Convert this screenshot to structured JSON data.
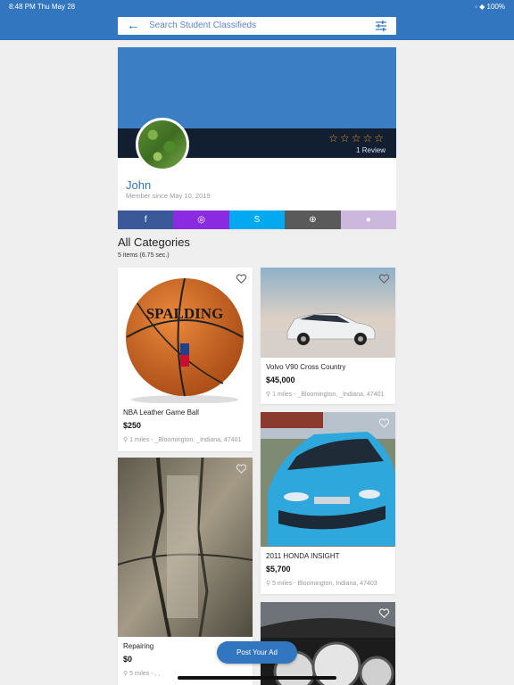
{
  "status": {
    "time": "8:48 PM   Thu May 28",
    "right": "◦ ◆ 100%"
  },
  "search": {
    "placeholder": "Search Student Classifieds",
    "back_icon": "back-arrow-icon",
    "filter_icon": "sliders-icon"
  },
  "profile": {
    "name": "John",
    "member_since": "Member since May 10, 2019",
    "stars": "☆☆☆☆☆",
    "reviews": "1 Review",
    "socials": [
      {
        "icon": "facebook-icon",
        "glyph": "f",
        "color": "#3b5998"
      },
      {
        "icon": "instagram-icon",
        "glyph": "◎",
        "color": "#8a2be2"
      },
      {
        "icon": "skype-icon",
        "glyph": "S",
        "color": "#00a9f0"
      },
      {
        "icon": "globe-icon",
        "glyph": "⊕",
        "color": "#5a5a5a"
      },
      {
        "icon": "location-icon",
        "glyph": "●",
        "color": "#cbb8dc"
      }
    ]
  },
  "section": {
    "title": "All Categories",
    "subtitle": "5 items (6.75 sec.)"
  },
  "listings": [
    {
      "title": "NBA Leather Game Ball",
      "price": "$250",
      "location": "1 miles - _Bloomington, _Indiana, 47401"
    },
    {
      "title": "Volvo V90 Cross Country",
      "price": "$45,000",
      "location": "1 miles - _Bloomington, _Indiana, 47401"
    },
    {
      "title": "2011 HONDA INSIGHT",
      "price": "$5,700",
      "location": "5 miles - Bloomington, Indiana, 47403"
    },
    {
      "title": "Repairing",
      "price": "$0",
      "location": "5 miles - , ,"
    },
    {
      "title": "",
      "price": "",
      "location": ""
    }
  ],
  "post_button": "Post Your Ad",
  "colors": {
    "brand": "#3276bf",
    "accent_star": "#f2962e"
  }
}
